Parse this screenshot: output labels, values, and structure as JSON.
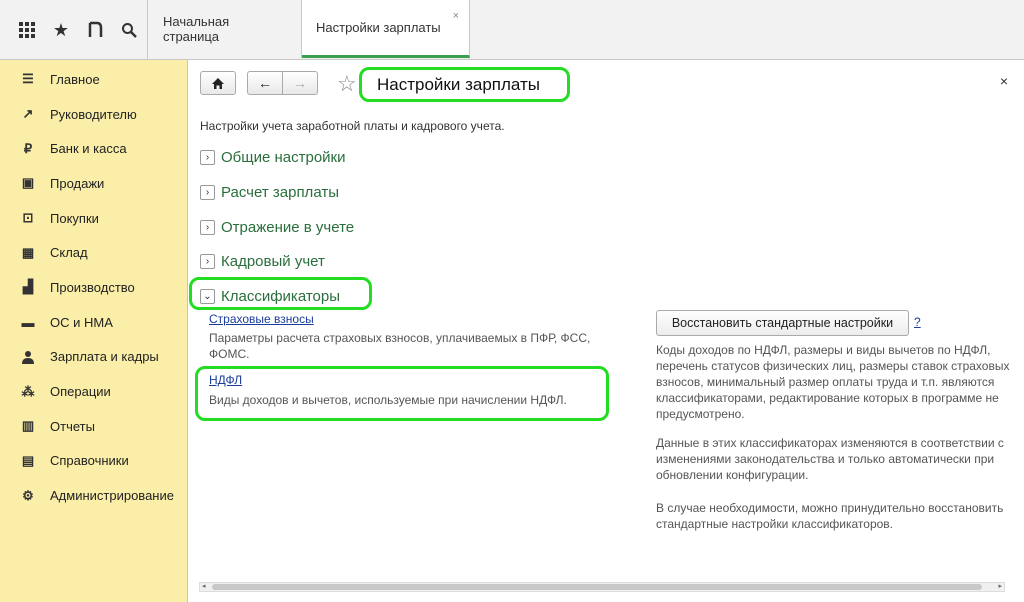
{
  "toolbar": {
    "icons": [
      "apps-grid-icon",
      "star-icon",
      "history-icon",
      "search-icon"
    ],
    "grid_glyph": "⋮⋮⋮",
    "star_glyph": "★",
    "history_glyph": "⊃",
    "search_glyph": "⚲"
  },
  "tabs": [
    {
      "label": "Начальная страница"
    },
    {
      "label": "Настройки зарплаты",
      "close": "×"
    }
  ],
  "sidebar": {
    "items": [
      {
        "label": "Главное",
        "icon": "☰"
      },
      {
        "label": "Руководителю",
        "icon": "↗"
      },
      {
        "label": "Банк и касса",
        "icon": "₽"
      },
      {
        "label": "Продажи",
        "icon": "▣"
      },
      {
        "label": "Покупки",
        "icon": "⊡"
      },
      {
        "label": "Склад",
        "icon": "▦"
      },
      {
        "label": "Производство",
        "icon": "▟"
      },
      {
        "label": "ОС и НМА",
        "icon": "▬"
      },
      {
        "label": "Зарплата и кадры",
        "icon": "👤"
      },
      {
        "label": "Операции",
        "icon": "⁂"
      },
      {
        "label": "Отчеты",
        "icon": "▥"
      },
      {
        "label": "Справочники",
        "icon": "▤"
      },
      {
        "label": "Администрирование",
        "icon": "⚙"
      }
    ]
  },
  "main": {
    "home_glyph": "⌂",
    "back_glyph": "←",
    "forward_glyph": "→",
    "star_glyph": "☆",
    "title": "Настройки зарплаты",
    "close_glyph": "×",
    "description": "Настройки учета заработной платы и кадрового учета.",
    "sections": [
      {
        "label": "Общие настройки",
        "toggle": "›"
      },
      {
        "label": "Расчет зарплаты",
        "toggle": "›"
      },
      {
        "label": "Отражение в учете",
        "toggle": "›"
      },
      {
        "label": "Кадровый учет",
        "toggle": "›"
      },
      {
        "label": "Классификаторы",
        "toggle": "⌄"
      }
    ],
    "classifiers": [
      {
        "link": "Страховые взносы",
        "desc": "Параметры расчета страховых взносов, уплачиваемых в ПФР, ФСС, ФОМС."
      },
      {
        "link": "НДФЛ",
        "desc": "Виды доходов и вычетов, используемые при начислении НДФЛ."
      }
    ],
    "restore_button": "Восстановить стандартные настройки",
    "help": "?",
    "info": [
      "Коды доходов по НДФЛ, размеры и виды вычетов по НДФЛ,\nперечень статусов физических лиц, размеры ставок страховых\nвзносов, минимальный размер оплаты труда и т.п. являются\nклассификаторами, редактирование которых в программе не\nпредусмотрено.",
      "Данные в этих классификаторах изменяются в соответствии с\nизменениями законодательства и только автоматически при\nобновлении конфигурации.",
      "В случае необходимости, можно принудительно восстановить\nстандартные настройки классификаторов."
    ],
    "scroll_left": "◂",
    "scroll_right": "▸"
  },
  "colors": {
    "sidebar_bg": "#faeea8",
    "highlight": "#22dd22",
    "section_text": "#2a6e3c",
    "link": "#1a3c9c"
  }
}
